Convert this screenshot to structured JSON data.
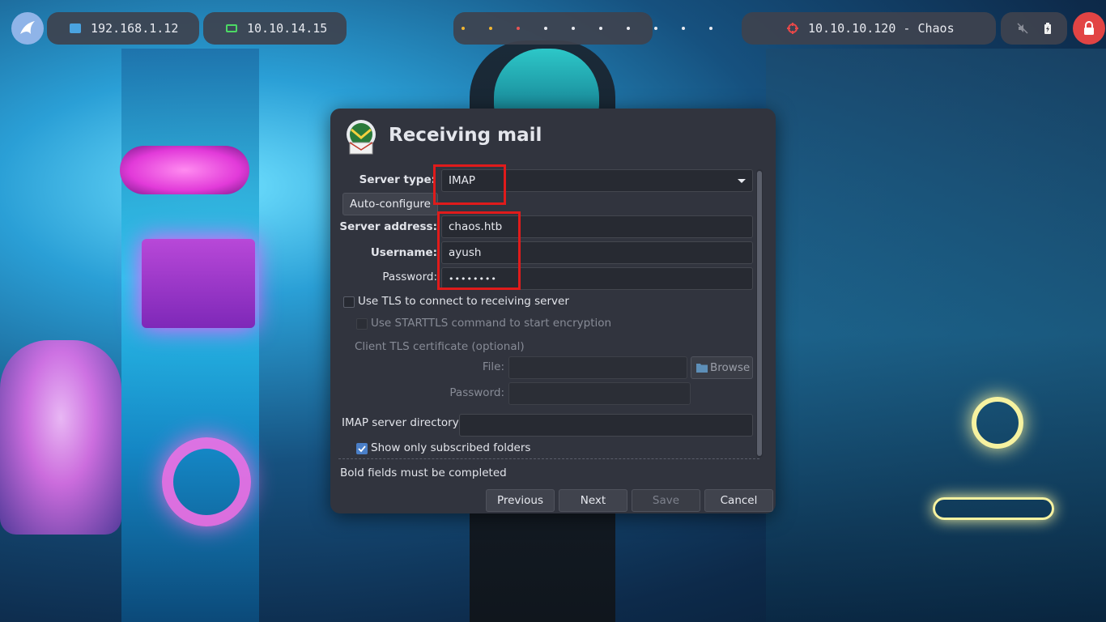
{
  "topbar": {
    "ip_local": "192.168.1.12",
    "ip_vpn": "10.10.14.15",
    "target": "10.10.10.120 - Chaos",
    "workspace_dot_colors": [
      "#f2b632",
      "#f2b632",
      "#e85454",
      "#e8eaf0",
      "#e8eaf0",
      "#e8eaf0",
      "#e8eaf0",
      "#e8eaf0",
      "#e8eaf0",
      "#e8eaf0"
    ],
    "icons": {
      "launcher": "swordfish-launcher-icon",
      "local": "network-icon",
      "vpn": "laptop-icon",
      "target": "crosshair-icon",
      "mute": "speaker-muted-icon",
      "battery": "battery-icon",
      "lock": "lock-icon"
    },
    "colors": {
      "local_icon": "#4aa3e0",
      "vpn_icon": "#4cd964",
      "target_icon": "#e84848",
      "lock_bg": "#e24444"
    }
  },
  "dialog": {
    "title": "Receiving mail",
    "server_type_label": "Server type:",
    "server_type_value": "IMAP",
    "auto_configure": "Auto-configure",
    "server_address_label": "Server address:",
    "server_address_value": "chaos.htb",
    "username_label": "Username:",
    "username_value": "ayush",
    "password_label": "Password:",
    "password_value": "••••••••",
    "use_tls_label": "Use TLS to connect to receiving server",
    "use_tls_checked": false,
    "starttls_label": "Use STARTTLS command to start encryption",
    "starttls_checked": false,
    "client_cert_label": "Client TLS certificate (optional)",
    "file_label": "File:",
    "file_value": "",
    "browse_label": "Browse",
    "cert_password_label": "Password:",
    "cert_password_value": "",
    "imap_dir_label": "IMAP server directory:",
    "imap_dir_value": "",
    "subscribed_label": "Show only subscribed folders",
    "subscribed_checked": true,
    "footer_note": "Bold fields must be completed",
    "buttons": {
      "previous": "Previous",
      "next": "Next",
      "save": "Save",
      "cancel": "Cancel"
    }
  }
}
